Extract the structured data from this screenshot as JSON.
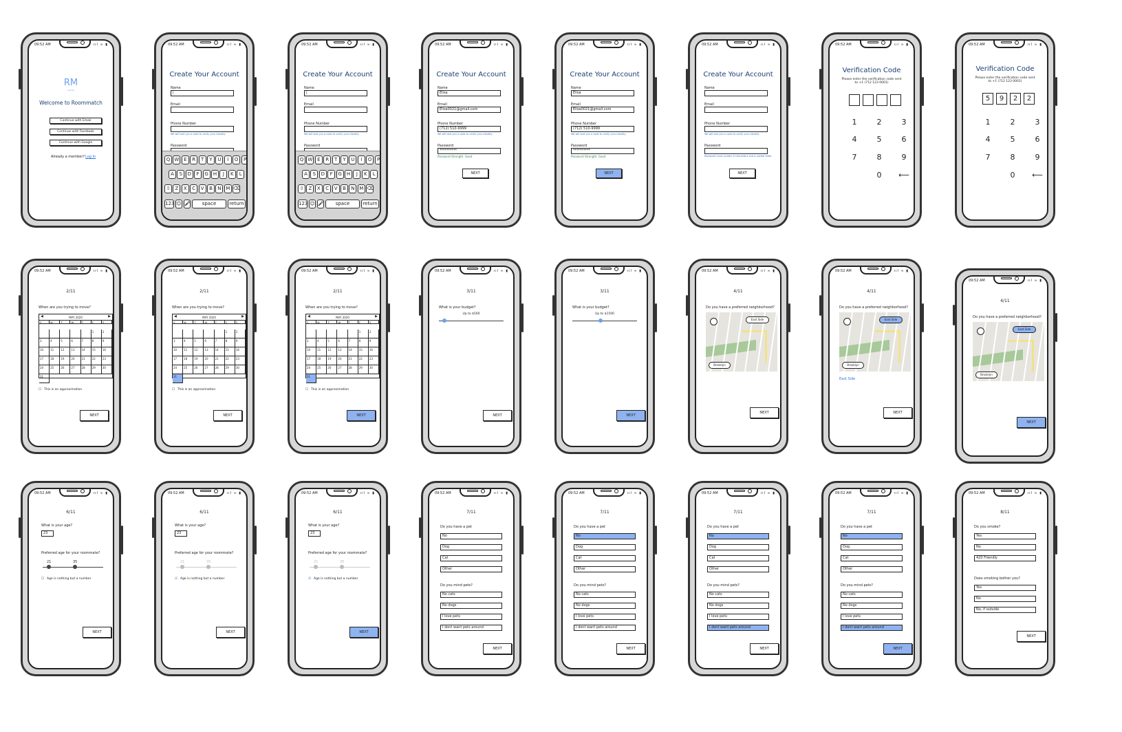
{
  "status": {
    "time": "09:52 AM",
    "signal": "ııl ≈ ▮"
  },
  "welcome": {
    "logo": "RM",
    "logo_sub": "atch",
    "logo_small": "roomm",
    "title": "Welcome to Roommatch",
    "buttons": [
      "Continue with Email",
      "Continue with Facebook",
      "Continue with Google"
    ],
    "member_text": "Already a member?",
    "login": "Log In"
  },
  "account": {
    "title": "Create Your Account",
    "labels": {
      "name": "Name",
      "email": "Email",
      "phone": "Phone Number",
      "password": "Password"
    },
    "values": {
      "name": "Elisa",
      "email": "Elisa0021@gmail.com",
      "phone": "(712) 510-9999",
      "password": "**********",
      "cursor": "|"
    },
    "phone_hint": "We will text you a code to verify your identity",
    "password_ok": "Password Strength: Good",
    "password_err": "Password must contain 8 characters and a capital letter",
    "next": "NEXT"
  },
  "keyboard": {
    "row1": [
      "Q",
      "W",
      "E",
      "R",
      "T",
      "Y",
      "U",
      "I",
      "O",
      "P"
    ],
    "row2": [
      "A",
      "S",
      "D",
      "F",
      "G",
      "H",
      "J",
      "K",
      "L"
    ],
    "row3": [
      "⇧",
      "Z",
      "X",
      "C",
      "V",
      "B",
      "N",
      "M",
      "⌫"
    ],
    "row4": [
      "123",
      "☺",
      "🎤",
      "space",
      "return"
    ]
  },
  "verify": {
    "title": "Verification Code",
    "text": "Please enter the verification code sent to +1 (712 123 0001)",
    "code": [
      "5",
      "9",
      "2",
      "2"
    ],
    "keys": [
      "1",
      "2",
      "3",
      "4",
      "5",
      "6",
      "7",
      "8",
      "9",
      "0",
      "⟵"
    ]
  },
  "move": {
    "step": "2/11",
    "question": "When are you trying to move?",
    "month": "MAY 2020",
    "days_header": [
      "S",
      "M",
      "T",
      "W",
      "T",
      "F",
      "S"
    ],
    "approx": "This is an approximation",
    "next": "NEXT"
  },
  "budget": {
    "step": "3/11",
    "question": "What is your budget?",
    "values": [
      "Up to $500",
      "Up to $1500"
    ],
    "fills": [
      0.05,
      0.4
    ],
    "next": "NEXT"
  },
  "hood": {
    "step": "4/11",
    "question": "Do you have a preferred neighborhood?",
    "east": "East Side",
    "brooklyn": "Brooklyn",
    "next": "NEXT"
  },
  "age": {
    "step": "6/11",
    "question": "What is your age?",
    "age": "23",
    "pref": "Preferred age for your roommate?",
    "range": [
      "21",
      "35"
    ],
    "nothing": "Age is nothing but a number",
    "next": "NEXT"
  },
  "pets": {
    "step": "7/11",
    "q1": "Do you have a pet",
    "have": [
      "No",
      "Dog",
      "Cat",
      "Other"
    ],
    "q2": "Do you mind pets?",
    "mind": [
      "No cats",
      "No dogs",
      "I love pets",
      "I dont want pets around"
    ],
    "next": "NEXT"
  },
  "smoke": {
    "step": "8/11",
    "q1": "Do you smoke?",
    "a1": [
      "Yes",
      "No",
      "420 Friendly"
    ],
    "q2": "Does smoking bother you?",
    "a2": [
      "Yes",
      "No",
      "No, if outside"
    ],
    "next": "NEXT"
  },
  "colors": {
    "accent": "#8fb3f0",
    "title": "#1b3d73",
    "link": "#2f6fd6",
    "success": "#2e8b57",
    "map_park": "#a8c99a",
    "map_road": "#f1e28a"
  }
}
